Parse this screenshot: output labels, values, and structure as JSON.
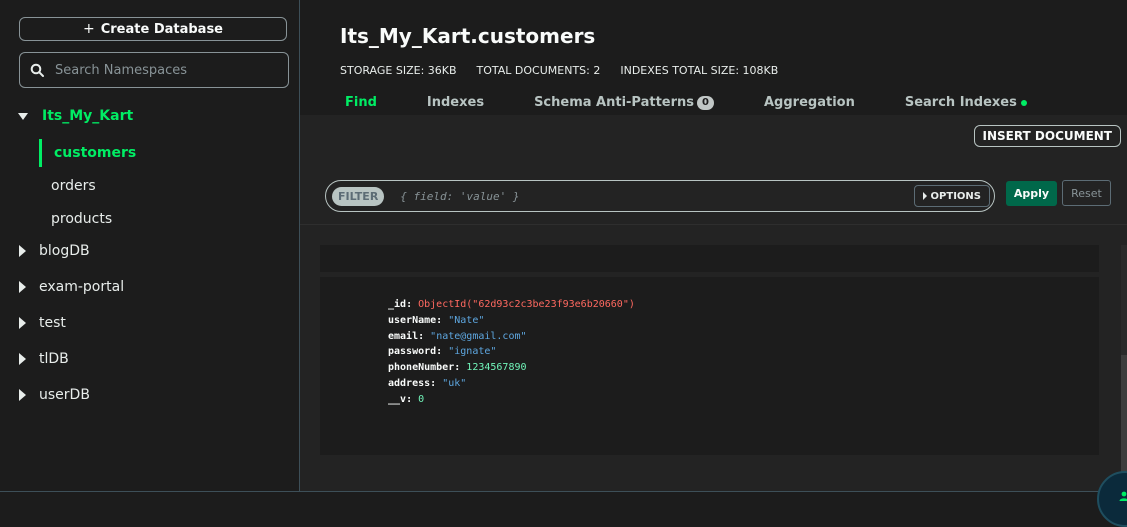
{
  "sidebar": {
    "create_database_label": "Create Database",
    "search_placeholder": "Search Namespaces",
    "active_db": "Its_My_Kart",
    "collections": [
      "customers",
      "orders",
      "products"
    ],
    "other_dbs": [
      "blogDB",
      "exam-portal",
      "test",
      "tlDB",
      "userDB"
    ]
  },
  "header": {
    "title": "Its_My_Kart.customers",
    "storage_size": "STORAGE SIZE: 36KB",
    "total_documents": "TOTAL DOCUMENTS: 2",
    "indexes_total_size": "INDEXES TOTAL SIZE: 108KB",
    "tabs": [
      {
        "label": "Find"
      },
      {
        "label": "Indexes"
      },
      {
        "label": "Schema Anti-Patterns",
        "badge": "0"
      },
      {
        "label": "Aggregation"
      },
      {
        "label": "Search Indexes"
      }
    ]
  },
  "toolbar": {
    "insert_document_label": "INSERT DOCUMENT",
    "filter_label": "FILTER",
    "filter_placeholder": "{ field: 'value' }",
    "options_label": "OPTIONS",
    "apply_label": "Apply",
    "reset_label": "Reset"
  },
  "document": {
    "fields": [
      {
        "key": "_id",
        "value": "ObjectId(\"62d93c2c3be23f93e6b20660\")",
        "kind": "oid"
      },
      {
        "key": "userName",
        "value": "\"Nate\"",
        "kind": "str"
      },
      {
        "key": "email",
        "value": "\"nate@gmail.com\"",
        "kind": "str"
      },
      {
        "key": "password",
        "value": "\"ignate\"",
        "kind": "str"
      },
      {
        "key": "phoneNumber",
        "value": "1234567890",
        "kind": "num"
      },
      {
        "key": "address",
        "value": "\"uk\"",
        "kind": "str"
      },
      {
        "key": "__v",
        "value": "0",
        "kind": "num"
      }
    ]
  },
  "colors": {
    "accent_green": "#00ed64",
    "apply_button": "#00684a",
    "background": "#1c1c1c"
  },
  "icons": {
    "search": "search-icon",
    "plus": "plus-icon",
    "chevron": "chevron-icon",
    "assistant": "person-icon"
  }
}
